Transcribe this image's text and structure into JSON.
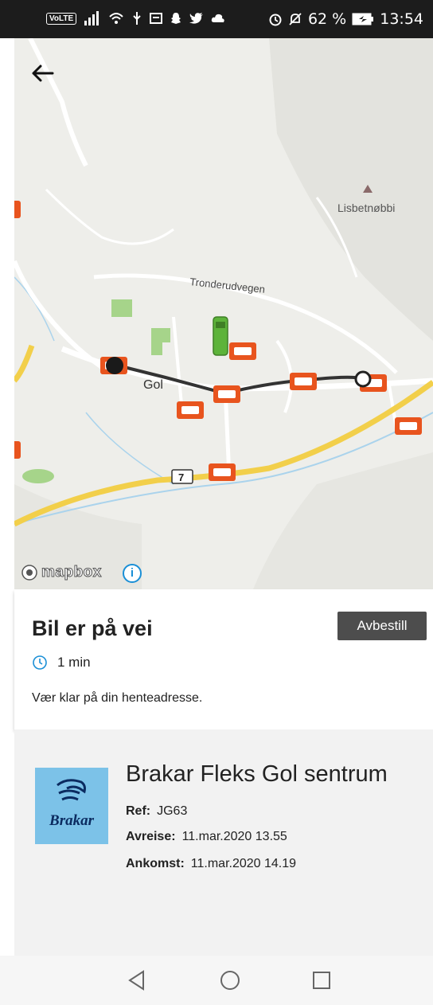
{
  "status_bar": {
    "volte": "VoLTE",
    "battery_percent": "62 %",
    "time": "13:54"
  },
  "map": {
    "place_label": "Lisbetnøbbi",
    "road_label": "Tronderudvegen",
    "town_label": "Gol",
    "route_number": "7",
    "attribution": "mapbox",
    "colors": {
      "road": "#f2cf4a",
      "route": "#333333",
      "bus_stop": "#e8541e",
      "vehicle": "#5db33a"
    }
  },
  "booking": {
    "title": "Bil er på vei",
    "cancel_label": "Avbestill",
    "eta": "1 min",
    "message": "Vær klar på din henteadresse."
  },
  "trip": {
    "logo_text": "Brakar",
    "name": "Brakar Fleks Gol sentrum",
    "ref_label": "Ref:",
    "ref_value": "JG63",
    "departure_label": "Avreise:",
    "departure_value": "11.mar.2020 13.55",
    "arrival_label": "Ankomst:",
    "arrival_value": "11.mar.2020 14.19"
  }
}
